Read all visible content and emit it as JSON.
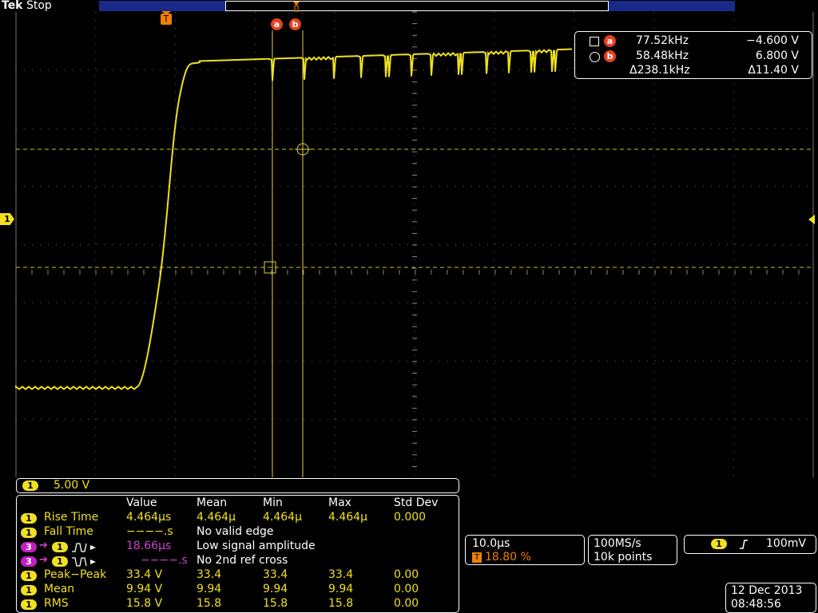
{
  "header": {
    "brand": "Tek",
    "status": "Stop"
  },
  "markers": {
    "trigger": "T",
    "cursor_a": "a",
    "cursor_b": "b",
    "channel1": "1"
  },
  "cursor_readout": {
    "a_freq": "77.52kHz",
    "a_volt": "−4.600 V",
    "b_freq": "58.48kHz",
    "b_volt": "6.800 V",
    "delta_freq": "Δ238.1kHz",
    "delta_volt": "Δ11.40 V"
  },
  "channel_scale": {
    "channel": "1",
    "value": "5.00 V"
  },
  "measurements": {
    "headers": [
      "Value",
      "Mean",
      "Min",
      "Max",
      "Std Dev"
    ],
    "rows": [
      {
        "ch": "1",
        "ch2": "",
        "label": "Rise Time",
        "value": "4.464µs",
        "mean": "4.464µ",
        "min": "4.464µ",
        "max": "4.464µ",
        "std": "0.000",
        "type": "full"
      },
      {
        "ch": "1",
        "ch2": "",
        "label": "Fall Time",
        "value": "−−−−.s",
        "msg": "No valid edge",
        "type": "msg"
      },
      {
        "ch": "3",
        "ch2": "1",
        "label": "",
        "value": "18.66µs",
        "msg": "Low signal amplitude",
        "type": "msg3"
      },
      {
        "ch": "3",
        "ch2": "1",
        "label": "",
        "value": "−−−−.s",
        "msg": "No 2nd ref cross",
        "type": "msg3"
      },
      {
        "ch": "1",
        "ch2": "",
        "label": "Peak−Peak",
        "value": "33.4 V",
        "mean": "33.4",
        "min": "33.4",
        "max": "33.4",
        "std": "0.00",
        "type": "full"
      },
      {
        "ch": "1",
        "ch2": "",
        "label": "Mean",
        "value": "9.94 V",
        "mean": "9.94",
        "min": "9.94",
        "max": "9.94",
        "std": "0.00",
        "type": "full"
      },
      {
        "ch": "1",
        "ch2": "",
        "label": "RMS",
        "value": "15.8 V",
        "mean": "15.8",
        "min": "15.8",
        "max": "15.8",
        "std": "0.00",
        "type": "full"
      }
    ]
  },
  "timebase": {
    "scale": "10.0µs",
    "trigger_pos": "18.80 %",
    "trigger_icon": "T"
  },
  "acquisition": {
    "rate": "100MS/s",
    "points": "10k points"
  },
  "trigger": {
    "channel": "1",
    "level": "100mV"
  },
  "datetime": {
    "date": "12 Dec  2013",
    "time": "08:48:56"
  },
  "colors": {
    "ch1": "#f0e020",
    "ch3": "#c020c0",
    "trigger": "#f08000",
    "cursor": "#e84020"
  }
}
